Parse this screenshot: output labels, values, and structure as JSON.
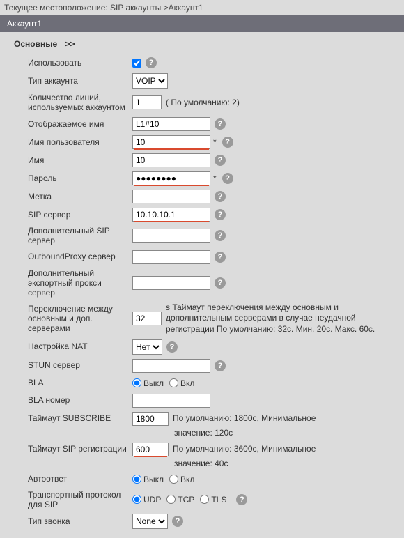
{
  "breadcrumb": "Текущее местоположение: SIP аккаунты >Аккаунт1",
  "title": "Аккаунт1",
  "section": "Основные",
  "section_arrow": ">>",
  "fields": {
    "enable": {
      "label": "Использовать",
      "checked": true
    },
    "account_type": {
      "label": "Тип аккаунта",
      "value": "VOIP"
    },
    "line_count": {
      "label": "Количество линий, используемых аккаунтом",
      "value": "1",
      "hint": "( По умолчанию: 2)"
    },
    "display_name": {
      "label": "Отображаемое имя",
      "value": "L1#10"
    },
    "username": {
      "label": "Имя пользователя",
      "value": "10"
    },
    "name": {
      "label": "Имя",
      "value": "10"
    },
    "password": {
      "label": "Пароль",
      "value": "●●●●●●●●"
    },
    "tag": {
      "label": "Метка",
      "value": ""
    },
    "sip_server": {
      "label": "SIP сервер",
      "value": "10.10.10.1"
    },
    "alt_sip": {
      "label": "Дополнительный SIP сервер",
      "value": ""
    },
    "outbound_proxy": {
      "label": "OutboundProxy сервер",
      "value": ""
    },
    "alt_export_proxy": {
      "label": "Дополнительный экспортный прокси сервер",
      "value": ""
    },
    "switch": {
      "label": "Переключение между основным и доп. серверами",
      "value": "32",
      "hint": "s Таймаут переключения между основным и дополнительным серверами в случае неудачной регистрации По умолчанию: 32с. Мин. 20с. Макс. 60с."
    },
    "nat": {
      "label": "Настройка NAT",
      "value": "Нет"
    },
    "stun": {
      "label": "STUN сервер",
      "value": ""
    },
    "bla": {
      "label": "BLA",
      "off": "Выкл",
      "on": "Вкл"
    },
    "bla_number": {
      "label": "BLA номер",
      "value": ""
    },
    "subscribe_timeout": {
      "label": "Таймаут SUBSCRIBE",
      "value": "1800",
      "hint1": "По умолчанию: 1800с, Минимальное",
      "hint2": "значение: 120с"
    },
    "sip_reg_timeout": {
      "label": "Таймаут SIP регистрации",
      "value": "600",
      "hint1": "По умолчанию: 3600с, Минимальное",
      "hint2": "значение: 40с"
    },
    "auto_answer": {
      "label": "Автоответ",
      "off": "Выкл",
      "on": "Вкл"
    },
    "transport": {
      "label": "Транспортный протокол для SIP",
      "udp": "UDP",
      "tcp": "TCP",
      "tls": "TLS"
    },
    "ring_type": {
      "label": "Тип звонка",
      "value": "None"
    }
  }
}
